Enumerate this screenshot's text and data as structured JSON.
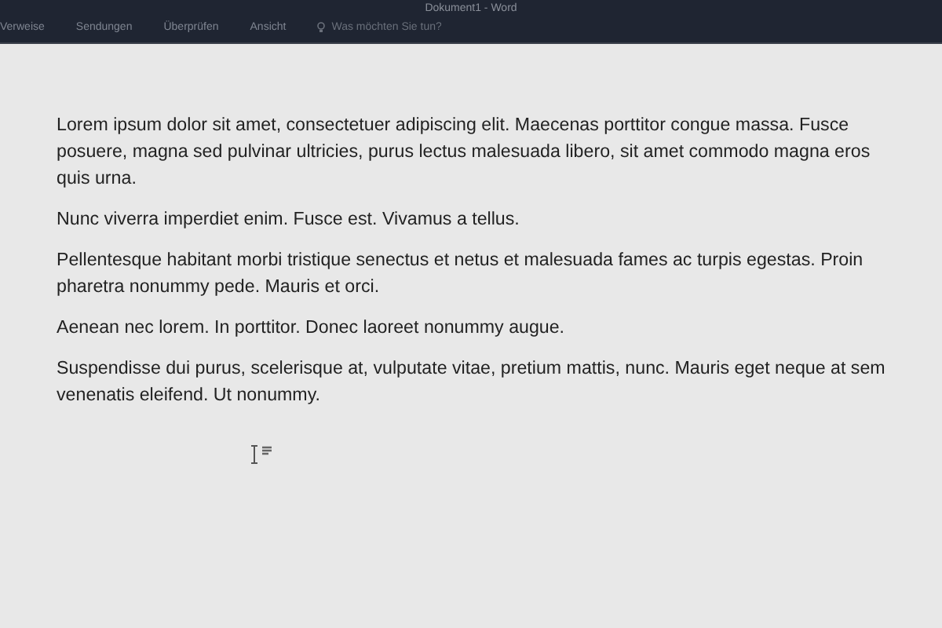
{
  "window": {
    "title": "Dokument1 - Word"
  },
  "ribbon_tabs": [
    {
      "label": "Verweise"
    },
    {
      "label": "Sendungen"
    },
    {
      "label": "Überprüfen"
    },
    {
      "label": "Ansicht"
    }
  ],
  "tell_me": {
    "placeholder": "Was möchten Sie tun?"
  },
  "document": {
    "paragraphs": [
      "Lorem ipsum dolor sit amet, consectetuer adipiscing elit. Maecenas porttitor congue massa. Fusce posuere, magna sed pulvinar ultricies, purus lectus malesuada libero, sit amet commodo magna eros quis urna.",
      "Nunc viverra imperdiet enim. Fusce est. Vivamus a tellus.",
      "Pellentesque habitant morbi tristique senectus et netus et malesuada fames ac turpis egestas. Proin pharetra nonummy pede. Mauris et orci.",
      "Aenean nec lorem. In porttitor. Donec laoreet nonummy augue.",
      "Suspendisse dui purus, scelerisque at, vulputate vitae, pretium mattis, nunc. Mauris eget neque at sem venenatis eleifend. Ut nonummy."
    ]
  }
}
